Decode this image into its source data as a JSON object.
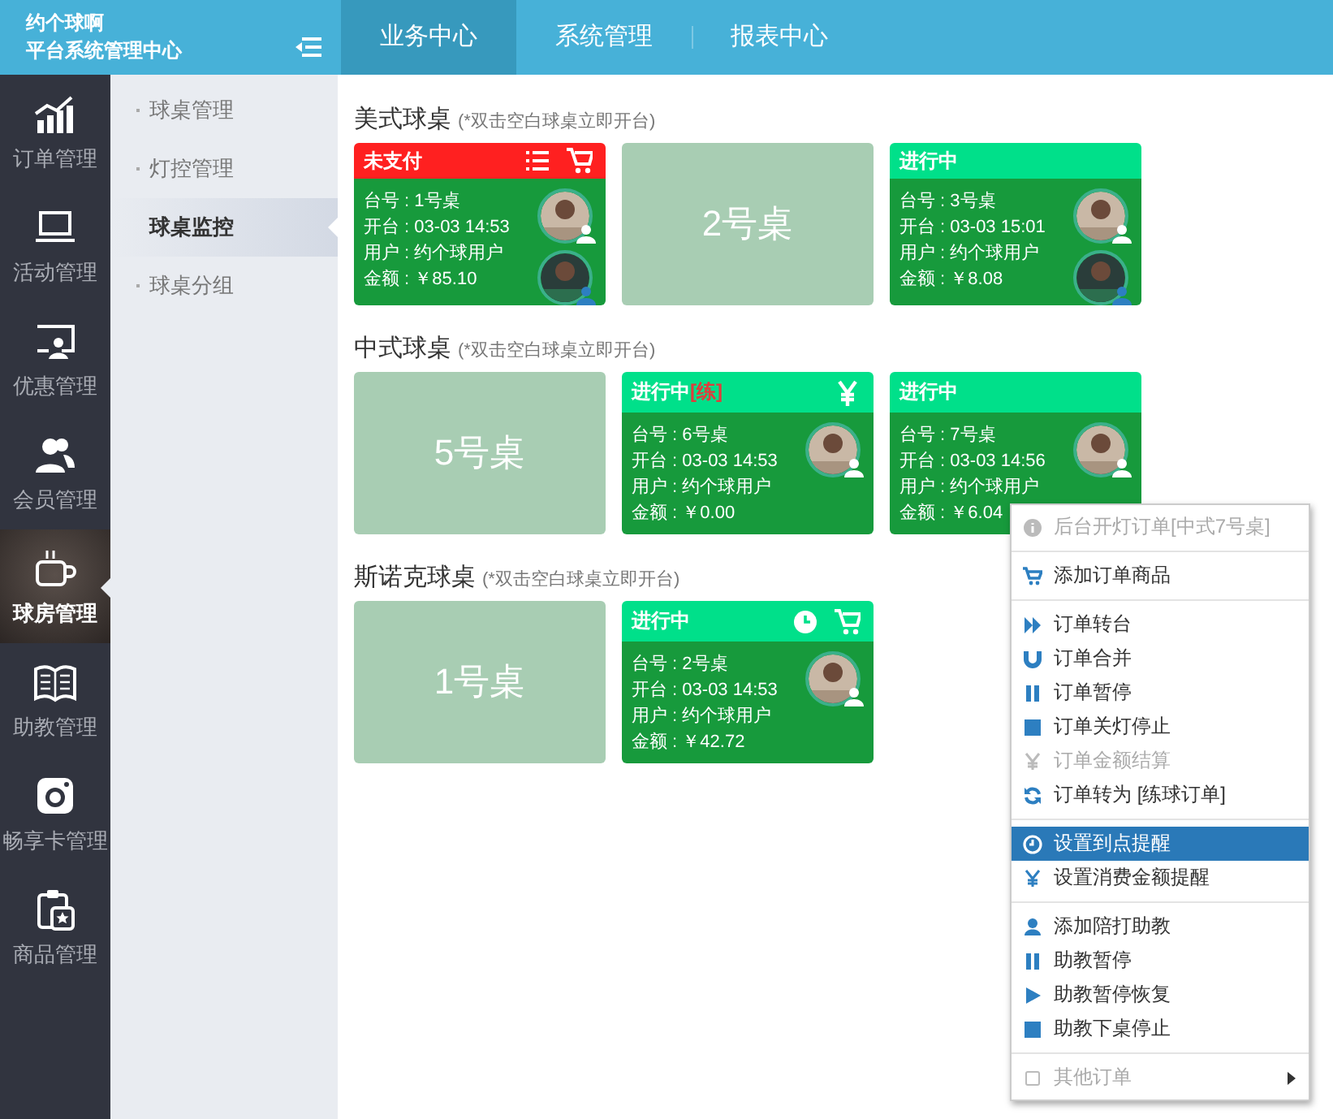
{
  "brand": {
    "lines": [
      "约个球啊",
      "平台系统管理中心"
    ]
  },
  "top_tabs": [
    {
      "label": "业务中心",
      "selected": true
    },
    {
      "label": "系统管理",
      "selected": false
    },
    {
      "label": "报表中心",
      "selected": false
    }
  ],
  "rail": [
    {
      "label": "订单管理",
      "kind": "chart",
      "selected": false
    },
    {
      "label": "活动管理",
      "kind": "laptop",
      "selected": false
    },
    {
      "label": "优惠管理",
      "kind": "screen",
      "selected": false
    },
    {
      "label": "会员管理",
      "kind": "users",
      "selected": false
    },
    {
      "label": "球房管理",
      "kind": "cup",
      "selected": true
    },
    {
      "label": "助教管理",
      "kind": "book",
      "selected": false
    },
    {
      "label": "畅享卡管理",
      "kind": "camera",
      "selected": false
    },
    {
      "label": "商品管理",
      "kind": "clipboard",
      "selected": false
    }
  ],
  "submenu": [
    {
      "label": "球桌管理",
      "selected": false
    },
    {
      "label": "灯控管理",
      "selected": false
    },
    {
      "label": "球桌监控",
      "selected": true
    },
    {
      "label": "球桌分组",
      "selected": false
    }
  ],
  "sections": [
    {
      "title": "美式球桌",
      "note": "(*双击空白球桌立即开台)",
      "tables": [
        {
          "kind": "occupied",
          "status": "未支付",
          "color": "#ff2020",
          "icons": [
            {
              "kind": "list"
            },
            {
              "kind": "cart"
            }
          ],
          "lines": [
            "台号 : 1号桌",
            "开台 : 03-03 14:53",
            "用户 : 约个球用户",
            "金额 : ￥85.10"
          ],
          "avatars": [
            {
              "kind": "member"
            },
            {
              "kind": "coach"
            }
          ]
        },
        {
          "kind": "empty",
          "label": "2号桌"
        },
        {
          "kind": "occupied",
          "status": "进行中",
          "color": "#00e08a",
          "lines": [
            "台号 : 3号桌",
            "开台 : 03-03 15:01",
            "用户 : 约个球用户",
            "金额 : ￥8.08"
          ],
          "avatars": [
            {
              "kind": "member"
            },
            {
              "kind": "coach"
            }
          ]
        }
      ]
    },
    {
      "title": "中式球桌",
      "note": "(*双击空白球桌立即开台)",
      "tables": [
        {
          "kind": "empty",
          "label": "5号桌"
        },
        {
          "kind": "occupied",
          "status": "进行中",
          "color": "#00e08a",
          "tag": "[练]",
          "icons": [
            {
              "kind": "yen"
            }
          ],
          "lines": [
            "台号 : 6号桌",
            "开台 : 03-03 14:53",
            "用户 : 约个球用户",
            "金额 : ￥0.00"
          ],
          "avatars": [
            {
              "kind": "member"
            }
          ]
        },
        {
          "kind": "occupied",
          "status": "进行中",
          "color": "#00e08a",
          "lines": [
            "台号 : 7号桌",
            "开台 : 03-03 14:56",
            "用户 : 约个球用户",
            "金额 : ￥6.04"
          ],
          "avatars": [
            {
              "kind": "member"
            }
          ]
        }
      ]
    },
    {
      "title": "斯诺克球桌",
      "note": "(*双击空白球桌立即开台)",
      "tables": [
        {
          "kind": "empty",
          "label": "1号桌"
        },
        {
          "kind": "occupied",
          "status": "进行中",
          "color": "#00e08a",
          "icons": [
            {
              "kind": "clock"
            },
            {
              "kind": "cart"
            }
          ],
          "lines": [
            "台号 : 2号桌",
            "开台 : 03-03 14:53",
            "用户 : 约个球用户",
            "金额 : ￥42.72"
          ],
          "avatars": [
            {
              "kind": "member"
            }
          ]
        }
      ]
    }
  ],
  "context_menu": {
    "groups": [
      [
        {
          "label": "后台开灯订单[中式7号桌]",
          "kind": "info",
          "disabled": true,
          "selected": false,
          "submenu": false
        }
      ],
      [
        {
          "label": "添加订单商品",
          "kind": "cart",
          "disabled": false,
          "selected": false,
          "submenu": false
        }
      ],
      [
        {
          "label": "订单转台",
          "kind": "forward",
          "disabled": false,
          "selected": false,
          "submenu": false
        },
        {
          "label": "订单合并",
          "kind": "magnet",
          "disabled": false,
          "selected": false,
          "submenu": false
        },
        {
          "label": "订单暂停",
          "kind": "pause",
          "disabled": false,
          "selected": false,
          "submenu": false
        },
        {
          "label": "订单关灯停止",
          "kind": "stop",
          "disabled": false,
          "selected": false,
          "submenu": false
        },
        {
          "label": "订单金额结算",
          "kind": "yen",
          "disabled": true,
          "selected": false,
          "submenu": false
        },
        {
          "label": "订单转为 [练球订单]",
          "kind": "refresh",
          "disabled": false,
          "selected": false,
          "submenu": false
        }
      ],
      [
        {
          "label": "设置到点提醒",
          "kind": "clock",
          "disabled": false,
          "selected": true,
          "submenu": false
        },
        {
          "label": "设置消费金额提醒",
          "kind": "yen",
          "disabled": false,
          "selected": false,
          "submenu": false
        }
      ],
      [
        {
          "label": "添加陪打助教",
          "kind": "user",
          "disabled": false,
          "selected": false,
          "submenu": false
        },
        {
          "label": "助教暂停",
          "kind": "pause",
          "disabled": false,
          "selected": false,
          "submenu": false
        },
        {
          "label": "助教暂停恢复",
          "kind": "play",
          "disabled": false,
          "selected": false,
          "submenu": false
        },
        {
          "label": "助教下桌停止",
          "kind": "stop",
          "disabled": false,
          "selected": false,
          "submenu": false
        }
      ],
      [
        {
          "label": "其他订单",
          "kind": "square",
          "disabled": true,
          "selected": false,
          "submenu": true
        }
      ]
    ]
  }
}
